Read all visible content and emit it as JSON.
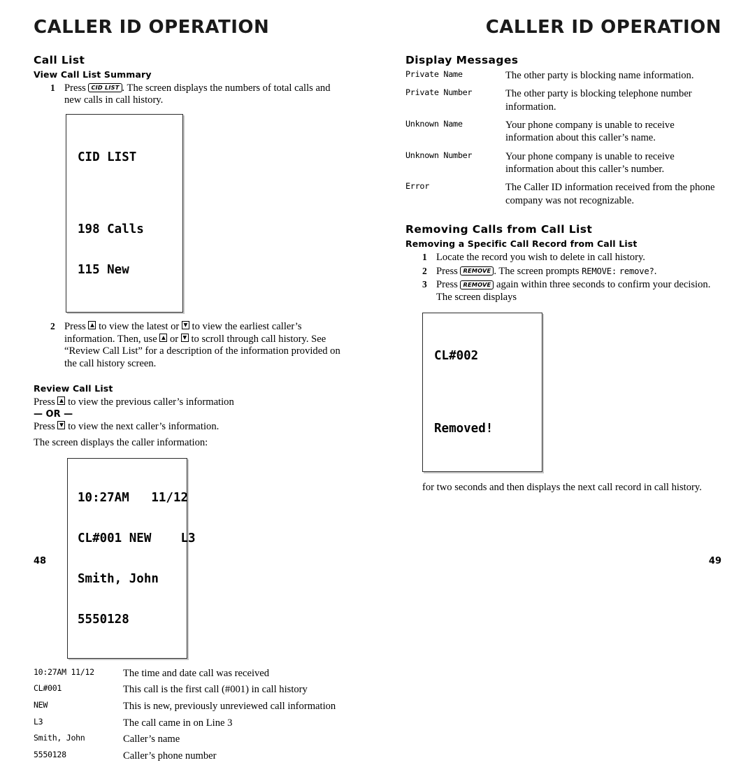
{
  "left_page": {
    "running_head": "CALLER ID OPERATION",
    "folio": "48",
    "section_title": "Call List",
    "subsection_title": "View Call List Summary",
    "step1": {
      "num": "1",
      "text_before": "Press",
      "key": "CID LIST",
      "text_after": ". The screen displays the numbers of total calls and new calls in call history."
    },
    "lcd_cidlist": {
      "line1": "CID LIST",
      "line2": "198 Calls",
      "line3": "115 New"
    },
    "step2": {
      "num": "2",
      "part1": "Press",
      "part2": "to view the latest or",
      "part3": "to view the earliest caller’s information. Then, use",
      "part4": "or",
      "part5": "to scroll through call history.  See “Review Call List” for a description of the information provided on the call history screen.",
      "up_key": "▲",
      "down_key": "▼"
    },
    "review_heading": "Review Call List",
    "review_line1_before": "Press",
    "review_line1_after": "to view the previous caller’s information",
    "review_or": "— OR —",
    "review_line2_before": "Press",
    "review_line2_after": "to view the next caller’s information.",
    "review_line3": "The screen displays the caller information:",
    "lcd_caller": {
      "line1": "10:27AM   11/12",
      "line2": "CL#001 NEW    L3",
      "line3": "Smith, John",
      "line4": "5550128"
    },
    "legend": [
      {
        "term": "10:27AM 11/12",
        "desc": "The time and date call was received"
      },
      {
        "term": "CL#001",
        "desc": "This call is the first call (#001) in call history"
      },
      {
        "term": "NEW",
        "desc": "This is new, previously unreviewed call information"
      },
      {
        "term": "L3",
        "desc": "The call came in on Line 3"
      },
      {
        "term": "Smith, John",
        "desc": "Caller’s name"
      },
      {
        "term": "5550128",
        "desc": "Caller’s phone number"
      }
    ]
  },
  "right_page": {
    "running_head": "CALLER ID OPERATION",
    "folio": "49",
    "display_messages_title": "Display Messages",
    "display_messages": [
      {
        "term": "Private Name",
        "desc": "The other party is blocking name information."
      },
      {
        "term": "Private Number",
        "desc": "The other party is blocking telephone number information."
      },
      {
        "term": "Unknown Name",
        "desc": "Your phone company is unable to receive information about this caller’s name."
      },
      {
        "term": "Unknown Number",
        "desc": "Your phone company is unable to receive information about this caller’s number."
      },
      {
        "term": "Error",
        "desc": "The Caller ID information received from the phone company was not recognizable."
      }
    ],
    "removing_title": "Removing Calls from Call List",
    "removing_subtitle": "Removing a Specific Call Record from Call List",
    "step1": {
      "num": "1",
      "text": "Locate the record you wish to delete in call history."
    },
    "step2": {
      "num": "2",
      "before": "Press",
      "key": "REMOVE",
      "mid": ". The screen prompts",
      "prompt_caps": "REMOVE:",
      "prompt_lower": "remove?",
      "after": "."
    },
    "step3": {
      "num": "3",
      "before": "Press",
      "key": "REMOVE",
      "after": "again within three seconds to confirm your decision. The screen displays"
    },
    "lcd_removed": {
      "line1": "CL#002",
      "line2": "Removed!"
    },
    "closing_text": "for two seconds and then displays the next call record in call history."
  }
}
